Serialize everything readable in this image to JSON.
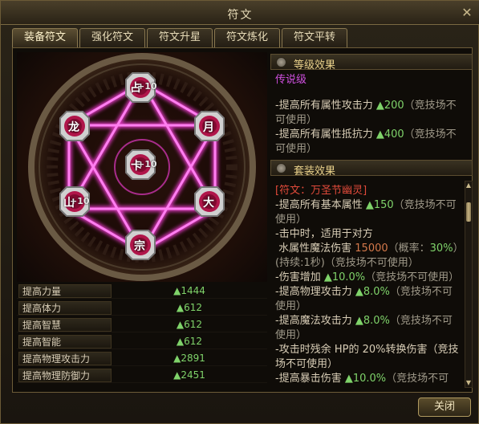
{
  "window": {
    "title": "符文"
  },
  "tabs": [
    {
      "label": "装备符文",
      "active": true
    },
    {
      "label": "强化符文",
      "active": false
    },
    {
      "label": "符文升星",
      "active": false
    },
    {
      "label": "符文炼化",
      "active": false
    },
    {
      "label": "符文平转",
      "active": false
    }
  ],
  "rune_slots": [
    {
      "glyph": "占",
      "value": "+10"
    },
    {
      "glyph": "龙",
      "value": ""
    },
    {
      "glyph": "月",
      "value": ""
    },
    {
      "glyph": "卡",
      "value": "+10"
    },
    {
      "glyph": "山",
      "value": "+10"
    },
    {
      "glyph": "大",
      "value": ""
    },
    {
      "glyph": "宗",
      "value": ""
    }
  ],
  "stats": [
    {
      "name": "提高力量",
      "value": "▲1444"
    },
    {
      "name": "提高体力",
      "value": "▲612"
    },
    {
      "name": "提高智慧",
      "value": "▲612"
    },
    {
      "name": "提高智能",
      "value": "▲612"
    },
    {
      "name": "提高物理攻击力",
      "value": "▲2891"
    },
    {
      "name": "提高物理防御力",
      "value": "▲2451"
    }
  ],
  "level_effect": {
    "header": "等级效果",
    "grade": "传说级",
    "lines": [
      {
        "pre": "-提高所有属性攻击力 ",
        "val": "▲200",
        "post": "（竞技场不可使用）"
      },
      {
        "pre": "-提高所有属性抵抗力 ",
        "val": "▲400",
        "post": "（竞技场不可使用）"
      }
    ]
  },
  "set_effect": {
    "header": "套装效果",
    "set_name": "[符文：万圣节幽灵]",
    "l1_pre": "-提高所有基本属性 ",
    "l1_val": "▲150",
    "l1_post": "（竞技场不可使用）",
    "l2": "-击中时，适用于对方",
    "l3_pre": "水属性魔法伤害 ",
    "l3_val": "15000",
    "l3_mid": "（概率：",
    "l3_pct": "30%",
    "l3_post": "）(持续:1秒)（竞技场不可使用）",
    "l4_pre": "-伤害增加 ",
    "l4_val": "▲10.0%",
    "l4_post": "（竞技场不可使用）",
    "l5_pre": "-提高物理攻击力 ",
    "l5_val": "▲8.0%",
    "l5_post": "（竞技场不可使用）",
    "l6_pre": "-提高魔法攻击力 ",
    "l6_val": "▲8.0%",
    "l6_post": "（竞技场不可使用）",
    "l7": "-攻击时残余 HP的 20%转换伤害（竞技场不可使用）",
    "l8_pre": "-提高暴击伤害 ",
    "l8_val": "▲10.0%",
    "l8_post": "（竞技场不可"
  },
  "buttons": {
    "close": "关闭"
  },
  "colors": {
    "accent": "#ff40e0",
    "gold": "#e8d08a",
    "green": "#7fd36a"
  }
}
